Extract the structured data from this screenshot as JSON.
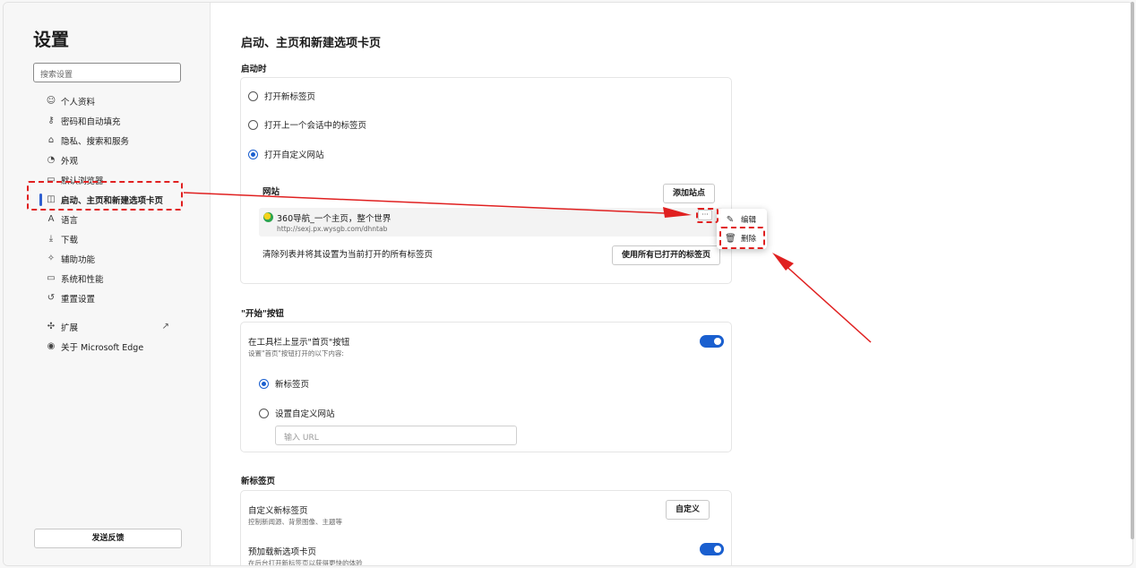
{
  "sidebar": {
    "title": "设置",
    "search_placeholder": "搜索设置",
    "items": [
      {
        "label": "个人资料",
        "icon": "profile-icon",
        "glyph": "☺"
      },
      {
        "label": "密码和自动填充",
        "icon": "key-icon",
        "glyph": "⚷"
      },
      {
        "label": "隐私、搜索和服务",
        "icon": "lock-icon",
        "glyph": "⌂"
      },
      {
        "label": "外观",
        "icon": "appearance-icon",
        "glyph": "◔"
      },
      {
        "label": "默认浏览器",
        "icon": "browser-icon",
        "glyph": "▭"
      },
      {
        "label": "启动、主页和新建选项卡页",
        "icon": "start-page-icon",
        "glyph": "◫"
      },
      {
        "label": "语言",
        "icon": "language-icon",
        "glyph": "A"
      },
      {
        "label": "下载",
        "icon": "download-icon",
        "glyph": "⤓"
      },
      {
        "label": "辅助功能",
        "icon": "accessibility-icon",
        "glyph": "✧"
      },
      {
        "label": "系统和性能",
        "icon": "system-icon",
        "glyph": "▭"
      },
      {
        "label": "重置设置",
        "icon": "reset-icon",
        "glyph": "↺"
      },
      {
        "label": "扩展",
        "icon": "extensions-icon",
        "glyph": "✣"
      },
      {
        "label": "关于 Microsoft Edge",
        "icon": "edge-icon",
        "glyph": "◉"
      }
    ],
    "feedback_label": "发送反馈"
  },
  "main": {
    "title": "启动、主页和新建选项卡页",
    "startup": {
      "heading": "启动时",
      "options": [
        "打开新标签页",
        "打开上一个会话中的标签页",
        "打开自定义网站"
      ],
      "sites_label": "网站",
      "add_site_label": "添加站点",
      "site": {
        "name": "360导航_一个主页，整个世界",
        "url": "http://sexj.px.wysgb.com/dhntab",
        "more": "···"
      },
      "clear_text": "清除列表并将其设置为当前打开的所有标签页",
      "use_all_tabs_label": "使用所有已打开的标签页"
    },
    "home": {
      "heading": "\"开始\"按钮",
      "show_label": "在工具栏上显示\"首页\"按钮",
      "show_sub": "设置\"首页\"按钮打开的以下内容:",
      "options": [
        "新标签页",
        "设置自定义网站"
      ],
      "url_placeholder": "输入 URL"
    },
    "newtab": {
      "heading": "新标签页",
      "custom_label": "自定义新标签页",
      "custom_sub": "控制新闻源、背景图像、主题等",
      "custom_button": "自定义",
      "preload_label": "预加载新选项卡页",
      "preload_sub": "在后台打开新标签页以获得更快的体验"
    }
  },
  "context_menu": {
    "edit_label": "编辑",
    "delete_label": "删除"
  },
  "colors": {
    "accent": "#1a5fcf",
    "annotation": "#e02020"
  }
}
